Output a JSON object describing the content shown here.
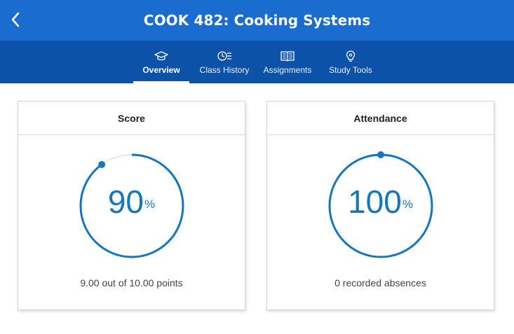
{
  "header": {
    "title": "COOK 482: Cooking Systems"
  },
  "tabs": [
    {
      "label": "Overview",
      "icon": "graduation-cap-icon",
      "active": true
    },
    {
      "label": "Class History",
      "icon": "history-icon",
      "active": false
    },
    {
      "label": "Assignments",
      "icon": "book-icon",
      "active": false
    },
    {
      "label": "Study Tools",
      "icon": "lightbulb-icon",
      "active": false
    }
  ],
  "score": {
    "title": "Score",
    "value": "90",
    "unit": "%",
    "percent": 90,
    "detail": "9.00 out of 10.00 points"
  },
  "attendance": {
    "title": "Attendance",
    "value": "100",
    "unit": "%",
    "percent": 100,
    "detail": "0 recorded absences"
  },
  "colors": {
    "header": "#1a6ccf",
    "tabbar": "#0c52a8",
    "accent": "#1477bd",
    "track": "#eeeeee"
  }
}
